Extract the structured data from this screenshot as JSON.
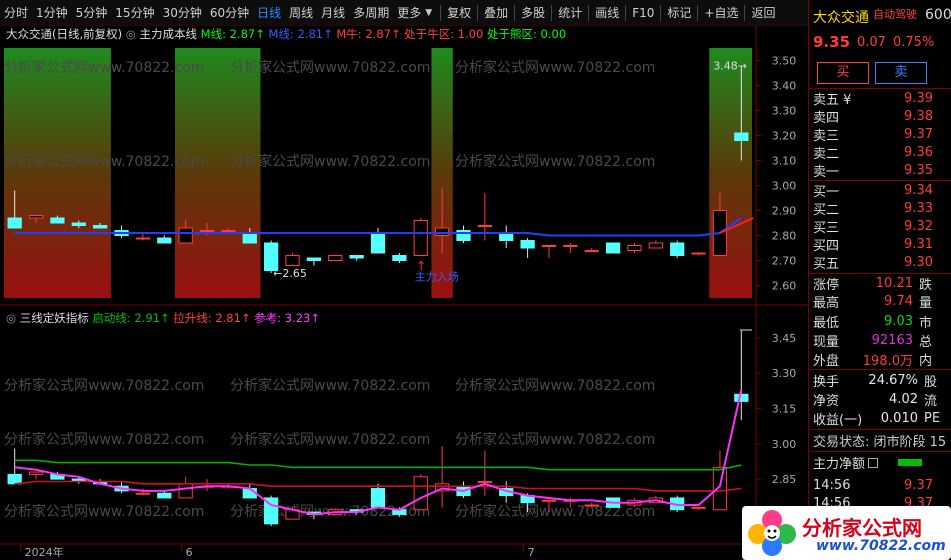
{
  "toolbar": {
    "items": [
      "分时",
      "1分钟",
      "5分钟",
      "15分钟",
      "30分钟",
      "60分钟",
      "日线",
      "周线",
      "月线",
      "多周期",
      "更多"
    ],
    "active_index": 6,
    "right_items": [
      "复权",
      "叠加",
      "多股",
      "统计",
      "画线",
      "F10",
      "标记",
      "+自选",
      "返回"
    ]
  },
  "main_chart": {
    "stock_label": "大众交通(日线,前复权)",
    "indicator_name": "主力成本线",
    "values": [
      {
        "label": "M线: 2.87",
        "color": "#00ff00"
      },
      {
        "label": "M线: 2.81",
        "color": "#3060ff"
      },
      {
        "label": "M牛: 2.87",
        "color": "#ff4040"
      },
      {
        "label": "处于牛区: 1.00",
        "color": "#ff4040"
      },
      {
        "label": "处于熊区: 0.00",
        "color": "#00ff00"
      }
    ],
    "y_ticks": [
      "3.50",
      "3.40",
      "3.30",
      "3.20",
      "3.10",
      "3.00",
      "2.90",
      "2.80",
      "2.70",
      "2.60"
    ],
    "annotations": {
      "low_label": "←2.65",
      "high_label": "3.48→",
      "entry_label": "主力入场"
    },
    "watermark": "分析家公式网www.70822.com"
  },
  "sub_chart": {
    "indicator_name": "三线定妖指标",
    "values": [
      {
        "label": "启动线: 2.91",
        "color": "#00c000"
      },
      {
        "label": "拉升线: 2.81",
        "color": "#ff4040"
      },
      {
        "label": "参考: 3.23",
        "color": "#ff40ff"
      }
    ],
    "y_ticks": [
      "3.45",
      "3.30",
      "3.15",
      "3.00",
      "2.85",
      "2.70"
    ],
    "x_labels": [
      "2024年",
      "6",
      "7"
    ]
  },
  "chart_data": {
    "type": "candlestick",
    "series": [
      {
        "name": "K线",
        "ohlc": [
          [
            2.87,
            2.83,
            2.98,
            2.83
          ],
          [
            2.87,
            2.88,
            2.88,
            2.85
          ],
          [
            2.87,
            2.85,
            2.88,
            2.85
          ],
          [
            2.85,
            2.84,
            2.86,
            2.83
          ],
          [
            2.84,
            2.83,
            2.85,
            2.83
          ],
          [
            2.82,
            2.8,
            2.84,
            2.79
          ],
          [
            2.79,
            2.79,
            2.81,
            2.78
          ],
          [
            2.79,
            2.77,
            2.8,
            2.77
          ],
          [
            2.77,
            2.83,
            2.86,
            2.77
          ],
          [
            2.82,
            2.82,
            2.85,
            2.8
          ],
          [
            2.82,
            2.82,
            2.83,
            2.81
          ],
          [
            2.81,
            2.77,
            2.83,
            2.77
          ],
          [
            2.77,
            2.66,
            2.78,
            2.65
          ],
          [
            2.68,
            2.72,
            2.73,
            2.68
          ],
          [
            2.71,
            2.7,
            2.71,
            2.68
          ],
          [
            2.7,
            2.72,
            2.72,
            2.7
          ],
          [
            2.72,
            2.71,
            2.72,
            2.7
          ],
          [
            2.81,
            2.73,
            2.83,
            2.73
          ],
          [
            2.72,
            2.7,
            2.73,
            2.69
          ],
          [
            2.72,
            2.86,
            2.87,
            2.72
          ],
          [
            2.8,
            2.83,
            2.99,
            2.73
          ],
          [
            2.82,
            2.78,
            2.84,
            2.77
          ],
          [
            2.84,
            2.84,
            2.97,
            2.78
          ],
          [
            2.81,
            2.78,
            2.84,
            2.75
          ],
          [
            2.78,
            2.75,
            2.79,
            2.71
          ],
          [
            2.76,
            2.76,
            2.76,
            2.71
          ],
          [
            2.76,
            2.76,
            2.77,
            2.73
          ],
          [
            2.74,
            2.74,
            2.75,
            2.74
          ],
          [
            2.77,
            2.73,
            2.77,
            2.73
          ],
          [
            2.74,
            2.76,
            2.77,
            2.73
          ],
          [
            2.75,
            2.77,
            2.78,
            2.75
          ],
          [
            2.77,
            2.72,
            2.78,
            2.71
          ],
          [
            2.73,
            2.73,
            2.73,
            2.72
          ],
          [
            2.72,
            2.9,
            2.97,
            2.72
          ],
          [
            3.21,
            3.18,
            3.48,
            3.1
          ]
        ]
      },
      {
        "name": "主力成本线",
        "values": [
          2.81,
          2.81,
          2.81,
          2.81,
          2.81,
          2.81,
          2.81,
          2.81,
          2.81,
          2.81,
          2.81,
          2.81,
          2.81,
          2.81,
          2.81,
          2.81,
          2.81,
          2.81,
          2.81,
          2.81,
          2.81,
          2.81,
          2.81,
          2.81,
          2.81,
          2.8,
          2.8,
          2.8,
          2.8,
          2.8,
          2.8,
          2.8,
          2.8,
          2.81,
          2.87
        ]
      },
      {
        "name": "启动线",
        "values": [
          2.93,
          2.93,
          2.92,
          2.92,
          2.92,
          2.92,
          2.92,
          2.92,
          2.92,
          2.92,
          2.92,
          2.91,
          2.91,
          2.9,
          2.9,
          2.9,
          2.9,
          2.9,
          2.9,
          2.9,
          2.9,
          2.9,
          2.9,
          2.9,
          2.9,
          2.89,
          2.89,
          2.89,
          2.89,
          2.89,
          2.89,
          2.89,
          2.89,
          2.89,
          2.91
        ]
      },
      {
        "name": "拉升线",
        "values": [
          2.83,
          2.84,
          2.84,
          2.84,
          2.84,
          2.84,
          2.83,
          2.83,
          2.83,
          2.83,
          2.83,
          2.83,
          2.82,
          2.82,
          2.82,
          2.82,
          2.82,
          2.82,
          2.82,
          2.82,
          2.82,
          2.82,
          2.82,
          2.82,
          2.81,
          2.81,
          2.81,
          2.81,
          2.81,
          2.81,
          2.8,
          2.8,
          2.8,
          2.8,
          2.81
        ]
      },
      {
        "name": "参考",
        "values": [
          2.9,
          2.89,
          2.87,
          2.86,
          2.83,
          2.81,
          2.8,
          2.8,
          2.81,
          2.82,
          2.82,
          2.81,
          2.74,
          2.72,
          2.7,
          2.71,
          2.71,
          2.73,
          2.72,
          2.77,
          2.81,
          2.8,
          2.83,
          2.8,
          2.78,
          2.77,
          2.76,
          2.76,
          2.75,
          2.75,
          2.76,
          2.74,
          2.74,
          2.82,
          3.23
        ]
      }
    ],
    "main_ylim": [
      2.55,
      3.55
    ],
    "sub_ylim": [
      2.6,
      3.5
    ],
    "bull_zones": [
      [
        0,
        5
      ],
      [
        8,
        12
      ],
      [
        20,
        21
      ],
      [
        33,
        35
      ]
    ]
  },
  "panel": {
    "stock_name": "大众交通",
    "tag": "自动驾驶",
    "code_prefix": "600",
    "price": "9.35",
    "change": "0.07",
    "pct": "0.75%",
    "buy_btn": "买",
    "sell_btn": "卖",
    "asks": [
      {
        "label": "卖五 ¥",
        "price": "9.39"
      },
      {
        "label": "卖四",
        "price": "9.38"
      },
      {
        "label": "卖三",
        "price": "9.37"
      },
      {
        "label": "卖二",
        "price": "9.36"
      },
      {
        "label": "卖一",
        "price": "9.35"
      }
    ],
    "bids": [
      {
        "label": "买一",
        "price": "9.34"
      },
      {
        "label": "买二",
        "price": "9.33"
      },
      {
        "label": "买三",
        "price": "9.32"
      },
      {
        "label": "买四",
        "price": "9.31"
      },
      {
        "label": "买五",
        "price": "9.30"
      }
    ],
    "stats": [
      {
        "label": "涨停",
        "value": "10.21",
        "color": "red",
        "extra": "跌"
      },
      {
        "label": "最高",
        "value": "9.74",
        "color": "red",
        "extra": "量"
      },
      {
        "label": "最低",
        "value": "9.03",
        "color": "green",
        "extra": "市"
      },
      {
        "label": "现量",
        "value": "92163",
        "color": "mag",
        "extra": "总"
      },
      {
        "label": "外盘",
        "value": "198.0万",
        "color": "red",
        "extra": "内"
      }
    ],
    "stats2": [
      {
        "label": "换手",
        "value": "24.67%",
        "extra": "股"
      },
      {
        "label": "净资",
        "value": "4.02",
        "extra": "流"
      },
      {
        "label": "收益(一)",
        "value": "0.010",
        "extra": "PE"
      }
    ],
    "trade_status": "交易状态: 闭市阶段 15",
    "net_inflow": "主力净额",
    "ticks": [
      {
        "time": "14:56",
        "price": "9.37"
      },
      {
        "time": "14:56",
        "price": "9.37"
      }
    ],
    "logo_text": "分析家公式网",
    "logo_url": "www.70822.com"
  }
}
